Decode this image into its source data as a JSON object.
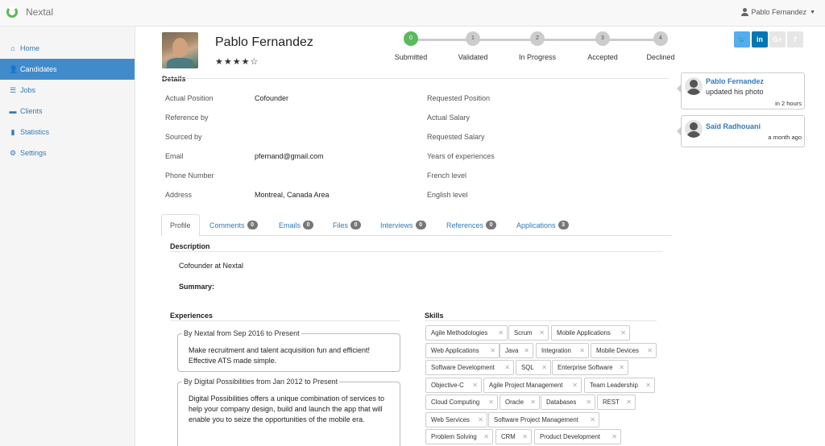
{
  "app": {
    "name": "Nextal"
  },
  "user_menu": {
    "name": "Pablo Fernandez"
  },
  "sidebar": {
    "items": [
      {
        "label": "Home",
        "icon": "home-icon",
        "glyph": "⌂"
      },
      {
        "label": "Candidates",
        "icon": "user-icon",
        "glyph": "👤"
      },
      {
        "label": "Jobs",
        "icon": "list-icon",
        "glyph": "☰"
      },
      {
        "label": "Clients",
        "icon": "folder-icon",
        "glyph": "▬"
      },
      {
        "label": "Statistics",
        "icon": "bar-chart-icon",
        "glyph": "▮"
      },
      {
        "label": "Settings",
        "icon": "gears-icon",
        "glyph": "⚙"
      }
    ]
  },
  "candidate": {
    "name": "Pablo Fernandez",
    "stars": "★★★★☆",
    "rating": 4
  },
  "pipeline": {
    "steps": [
      {
        "number": "0",
        "label": "Submitted"
      },
      {
        "number": "1",
        "label": "Validated"
      },
      {
        "number": "2",
        "label": "In Progress"
      },
      {
        "number": "3",
        "label": "Accepted"
      },
      {
        "number": "4",
        "label": "Declined"
      }
    ]
  },
  "social": {
    "twitter": "🐦",
    "linkedin": "in",
    "googleplus": "G+",
    "facebook": "f"
  },
  "details": {
    "title": "Details",
    "left": [
      {
        "label": "Actual Position",
        "value": "Cofounder"
      },
      {
        "label": "Reference by",
        "value": ""
      },
      {
        "label": "Sourced by",
        "value": ""
      },
      {
        "label": "Email",
        "value": "pfernand@gmail.com"
      },
      {
        "label": "Phone Number",
        "value": ""
      },
      {
        "label": "Address",
        "value": "Montreal, Canada Area"
      }
    ],
    "right": [
      {
        "label": "Requested Position",
        "value": ""
      },
      {
        "label": "Actual Salary",
        "value": ""
      },
      {
        "label": "Requested Salary",
        "value": ""
      },
      {
        "label": "Years of experiences",
        "value": ""
      },
      {
        "label": "French level",
        "value": ""
      },
      {
        "label": "English level",
        "value": ""
      }
    ]
  },
  "feed": [
    {
      "name": "Pablo Fernandez",
      "text": "updated his photo",
      "time": "in 2 hours"
    },
    {
      "name": "Saïd Radhouani",
      "text": "",
      "time": "a month ago"
    }
  ],
  "tabs": [
    {
      "label": "Profile",
      "count": null
    },
    {
      "label": "Comments",
      "count": "0"
    },
    {
      "label": "Emails",
      "count": "0"
    },
    {
      "label": "Files",
      "count": "0"
    },
    {
      "label": "Interviews",
      "count": "0"
    },
    {
      "label": "References",
      "count": "0"
    },
    {
      "label": "Applications",
      "count": "3"
    }
  ],
  "profile": {
    "description_title": "Description",
    "description": "Cofounder at Nextal",
    "summary_label": "Summary:",
    "experiences_title": "Experiences",
    "skills_title": "Skills",
    "experiences": [
      {
        "legend": "By Nextal from Sep 2016 to Present",
        "text": "Make recruitment and talent acquisition fun and efficient! Effective ATS made simple."
      },
      {
        "legend": "By Digital Possibilities from Jan 2012 to Present",
        "text": "Digital Possibilities offers a unique combination of services to help your company design, build and launch the app that will enable you to seize the opportunities of the mobile era."
      }
    ],
    "skills": [
      "Agile Methodologies",
      "Scrum",
      "Mobile Applications",
      "Web Applications",
      "Java",
      "Integration",
      "Mobile Devices",
      "Software Development",
      "SQL",
      "Enterprise Software",
      "Objective-C",
      "Agile Project Management",
      "Team Leadership",
      "Cloud Computing",
      "Oracle",
      "Databases",
      "REST",
      "Web Services",
      "Software Project Management",
      "Problem Solving",
      "CRM",
      "Product Development"
    ],
    "skill_remove": "✕"
  }
}
